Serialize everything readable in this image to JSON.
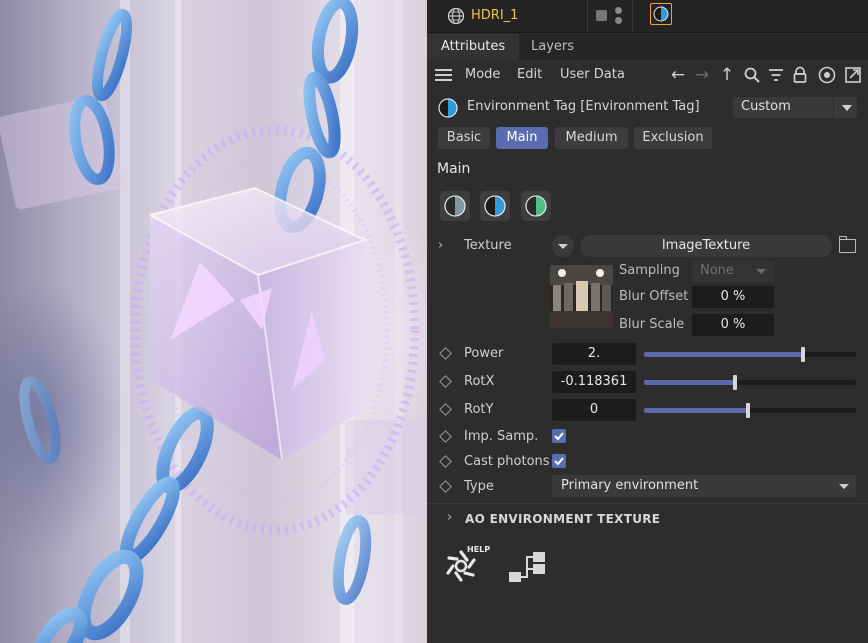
{
  "object_row": {
    "name": "HDRI_1"
  },
  "panel_tabs": [
    {
      "label": "Attributes",
      "active": true
    },
    {
      "label": "Layers",
      "active": false
    }
  ],
  "toolbar": {
    "menu": [
      "Mode",
      "Edit",
      "User Data"
    ],
    "icons": [
      "arrow-left-icon",
      "arrow-right-icon",
      "arrow-up-icon",
      "search-icon",
      "filter-icon",
      "lock-icon",
      "target-icon",
      "new-window-icon"
    ]
  },
  "tag": {
    "title": "Environment Tag [Environment Tag]",
    "preset": "Custom"
  },
  "group_tabs": [
    {
      "label": "Basic",
      "active": false
    },
    {
      "label": "Main",
      "active": true
    },
    {
      "label": "Medium",
      "active": false
    },
    {
      "label": "Exclusion",
      "active": false
    }
  ],
  "section": {
    "title": "Main"
  },
  "texture": {
    "label": "Texture",
    "shader": "ImageTexture",
    "sampling_label": "Sampling",
    "sampling_value": "None",
    "blur_offset_label": "Blur Offset",
    "blur_offset": "0 %",
    "blur_scale_label": "Blur Scale",
    "blur_scale": "0 %"
  },
  "params": {
    "power": {
      "label": "Power",
      "value": "2.",
      "slider_fraction": 0.75
    },
    "rotx": {
      "label": "RotX",
      "value": "-0.118361",
      "slider_fraction": 0.43
    },
    "roty": {
      "label": "RotY",
      "value": "0",
      "slider_fraction": 0.49
    },
    "imp_samp": {
      "label": "Imp. Samp.",
      "checked": true
    },
    "cast_photons": {
      "label": "Cast photons",
      "checked": true
    },
    "type": {
      "label": "Type",
      "value": "Primary environment"
    }
  },
  "ao_section": {
    "label": "AO ENVIRONMENT TEXTURE"
  },
  "help": {
    "label": "HELP"
  },
  "colors": {
    "accent": "#5a6bb0",
    "object_name": "#f0c050",
    "tag_highlight": "#f0a23a",
    "panel_bg": "#2d2d2d"
  }
}
